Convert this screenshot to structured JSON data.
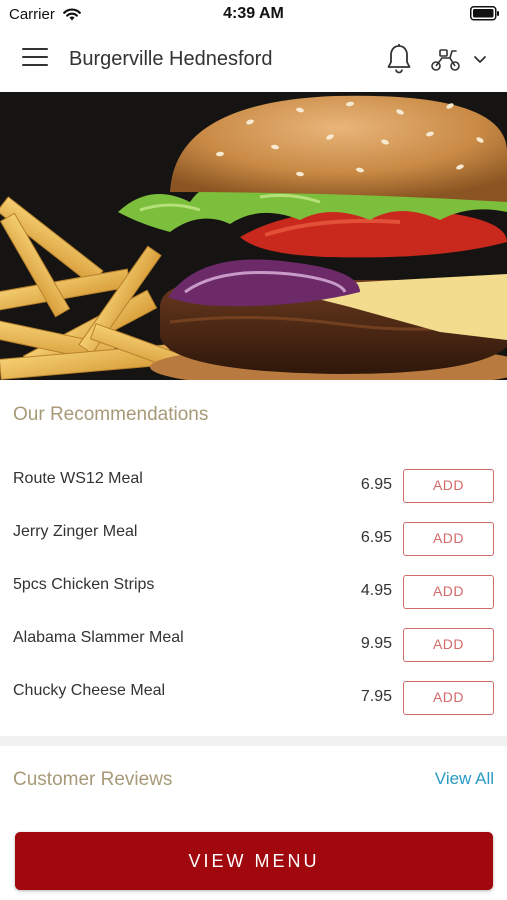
{
  "status_bar": {
    "carrier": "Carrier",
    "time": "4:39 AM",
    "icons": [
      "wifi-icon",
      "battery-icon"
    ]
  },
  "header": {
    "title": "Burgerville Hednesford",
    "icons": [
      "menu-icon",
      "bell-icon",
      "scooter-icon",
      "chevron-down-icon"
    ]
  },
  "hero": {
    "image": "burger-with-fries-photo"
  },
  "recommendations": {
    "heading": "Our Recommendations",
    "items": [
      {
        "name": "Route WS12 Meal",
        "price": "6.95",
        "action": "ADD"
      },
      {
        "name": "Jerry Zinger Meal",
        "price": "6.95",
        "action": "ADD"
      },
      {
        "name": "5pcs Chicken Strips",
        "price": "4.95",
        "action": "ADD"
      },
      {
        "name": "Alabama Slammer Meal",
        "price": "9.95",
        "action": "ADD"
      },
      {
        "name": "Chucky Cheese Meal",
        "price": "7.95",
        "action": "ADD"
      }
    ]
  },
  "reviews": {
    "heading": "Customer Reviews",
    "view_all": "View All"
  },
  "footer": {
    "view_menu": "VIEW MENU"
  },
  "colors": {
    "brand_red": "#a0080e",
    "add_outline": "#d36a6a",
    "heading_tan": "#a89a78",
    "link_blue": "#2a9bc5"
  }
}
